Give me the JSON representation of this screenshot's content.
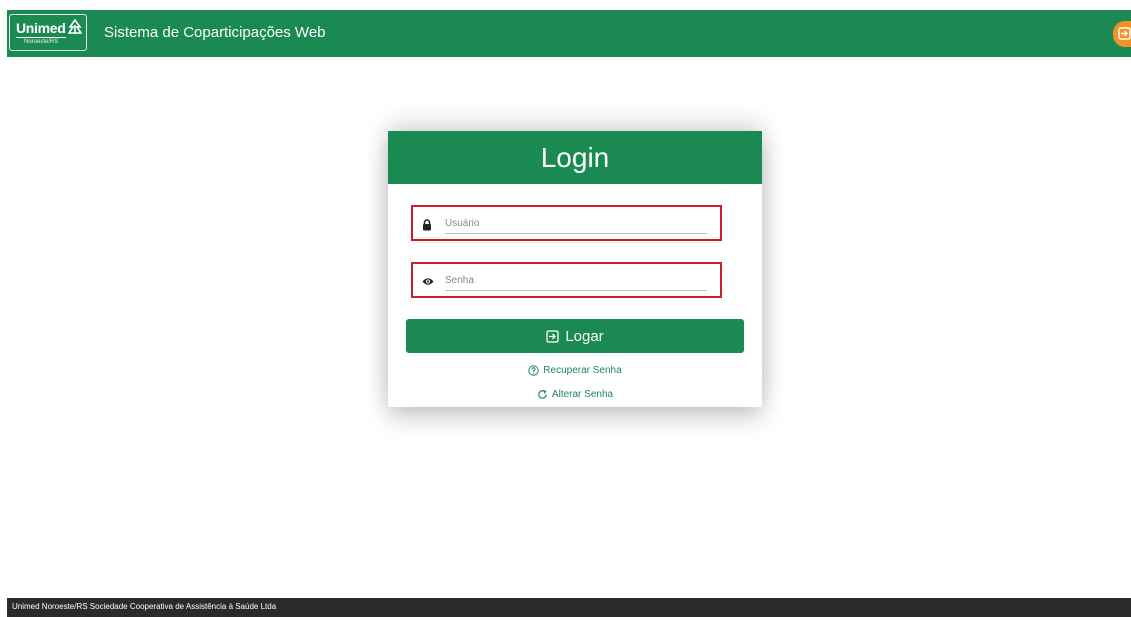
{
  "header": {
    "logo_text": "Unimed",
    "logo_subtext": "Noroeste/RS",
    "app_title": "Sistema de Coparticipações Web",
    "exit_icon": "exit-icon",
    "brand_color": "#1a8a52",
    "accent_color": "#f29125"
  },
  "login": {
    "title": "Login",
    "username": {
      "placeholder": "Usuário",
      "value": "",
      "icon": "lock-icon"
    },
    "password": {
      "placeholder": "Senha",
      "value": "",
      "icon": "eye-icon"
    },
    "submit_label": "Logar",
    "submit_icon": "login-icon",
    "recover_label": "Recuperar Senha",
    "recover_icon": "help-circle-icon",
    "change_label": "Alterar Senha",
    "change_icon": "refresh-icon",
    "highlight_color": "#c8202b"
  },
  "footer": {
    "text": "Unimed Noroeste/RS Sociedade Cooperativa de Assistência à Saúde Ltda"
  }
}
